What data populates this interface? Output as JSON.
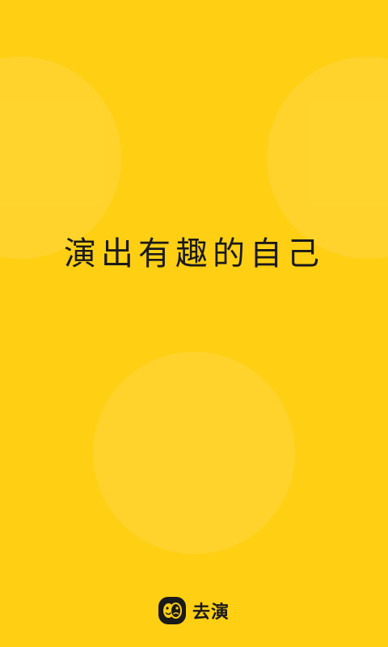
{
  "splash": {
    "slogan": "演出有趣的自己",
    "background_color": "#FFCF14",
    "text_color": "#1A1A1A"
  },
  "brand": {
    "name": "去演",
    "logo_icon": "two-faces-logo-icon"
  }
}
